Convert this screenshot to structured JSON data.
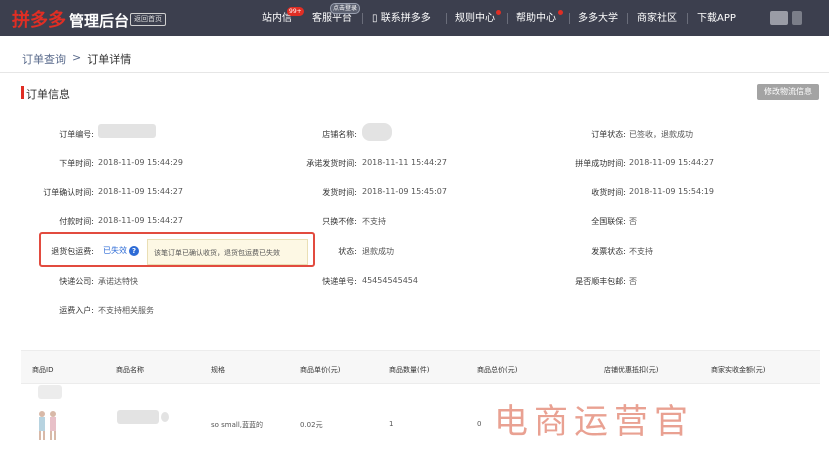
{
  "nav": {
    "logo_brand": "拼多多",
    "logo_admin": "管理后台",
    "back_home": "返回首页",
    "items": {
      "inbox": "站内信",
      "inbox_badge": "99+",
      "service": "客服平台",
      "service_badge": "点击登录",
      "contact": "联系拼多多",
      "rules": "规则中心",
      "help": "帮助中心",
      "university": "多多大学",
      "community": "商家社区",
      "download": "下载APP"
    }
  },
  "breadcrumb": {
    "parent": "订单查询",
    "separator": ">",
    "current": "订单详情"
  },
  "section": {
    "title": "订单信息",
    "edit_logistics_button": "修改物流信息"
  },
  "order": {
    "order_no_label": "订单编号:",
    "shop_name_label": "店铺名称:",
    "status_label": "订单状态:",
    "status_value": "已签收，退款成功",
    "place_time_label": "下单时间:",
    "place_time_value": "2018-11-09 15:44:29",
    "promise_ship_label": "承诺发货时间:",
    "promise_ship_value": "2018-11-11 15:44:27",
    "group_time_label": "拼单成功时间:",
    "group_time_value": "2018-11-09 15:44:27",
    "confirm_time_label": "订单确认时间:",
    "confirm_time_value": "2018-11-09 15:44:27",
    "ship_time_label": "发货时间:",
    "ship_time_value": "2018-11-09 15:45:07",
    "receive_time_label": "收货时间:",
    "receive_time_value": "2018-11-09 15:54:19",
    "pay_time_label": "付款时间:",
    "pay_time_value": "2018-11-09 15:44:27",
    "only_hk_label": "只换不修:",
    "only_hk_value": "不支持",
    "nationwide_label": "全国联保:",
    "nationwide_value": "否",
    "return_ins_label": "退货包运费:",
    "return_ins_value": "已失效",
    "return_ins_tip": "该笔订单已确认收货，退货包运费已失效",
    "status2_label": "状态:",
    "status2_value": "退款成功",
    "invoice_label": "发票状态:",
    "invoice_value": "不支持",
    "express_label": "快递公司:",
    "express_value": "承诺达特快",
    "tracking_label": "快递单号:",
    "tracking_value": "45454545454",
    "sf_label": "是否顺丰包邮:",
    "sf_value": "否",
    "freight_label": "运费入户:",
    "freight_value": "不支持相关服务"
  },
  "table": {
    "headers": [
      "商品ID",
      "商品名称",
      "规格",
      "商品单价(元)",
      "商品数量(件)",
      "商品总价(元)",
      "店铺优惠抵扣(元)",
      "商家实收金额(元)"
    ],
    "row": {
      "spec": "so small,蓝蓝的",
      "unit_price": "0.02元",
      "quantity": "1",
      "total": "0"
    }
  },
  "watermark": "电商运营官"
}
